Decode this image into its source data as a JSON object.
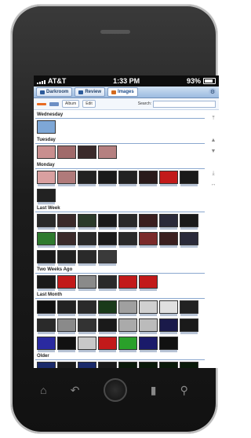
{
  "status": {
    "carrier": "AT&T",
    "time": "1:33 PM",
    "battery": "93%"
  },
  "tabs": [
    {
      "label": "Darkroom",
      "active": false
    },
    {
      "label": "Review",
      "active": false
    },
    {
      "label": "Images",
      "active": true
    }
  ],
  "toolbar": {
    "album_label": "Album",
    "edit_label": "Edit",
    "search_label": "Search:",
    "search_value": ""
  },
  "sections": [
    {
      "title": "Wednesday",
      "thumbs": [
        "#7ea7d6"
      ]
    },
    {
      "title": "Tuesday",
      "thumbs": [
        "#c98f8f",
        "#a06a6a",
        "#3a2a2a",
        "#b58080"
      ]
    },
    {
      "title": "Monday",
      "thumbs": [
        "#d9a0a0",
        "#b07a7a",
        "#222",
        "#1a1a1a",
        "#222",
        "#2a1a1a",
        "#c21a1a",
        "#1a1a1a",
        "#222"
      ]
    },
    {
      "title": "Last Week",
      "thumbs": [
        "#2a2a2a",
        "#3a2a2a",
        "#2a3a2a",
        "#1a1a1a",
        "#2a2a2a",
        "#3a1f1f",
        "#2a2a3a",
        "#1a1a1a",
        "#2e7a2e",
        "#3a2a2a",
        "#2a2a2a",
        "#1a1a1a",
        "#2a2a2a",
        "#7a2a2a",
        "#3a1f1f",
        "#2a2a3a",
        "#1a1a1a",
        "#222",
        "#2a2a2a",
        "#3a3a3a"
      ]
    },
    {
      "title": "Two Weeks Ago",
      "thumbs": [
        "#1a1a1a",
        "#c21a1a",
        "#8a8a8a",
        "#2a2a2a",
        "#c21a1a",
        "#c21a1a"
      ]
    },
    {
      "title": "Last Month",
      "thumbs": [
        "#111",
        "#222",
        "#2a2a2a",
        "#1a3a1a",
        "#a0a0a0",
        "#d0d0d0",
        "#e0e0e0",
        "#222",
        "#2a2a2a",
        "#8a8a8a",
        "#333",
        "#1a1a1a",
        "#aaa",
        "#bbb",
        "#1a1a4a",
        "#1a1a1a",
        "#2a2aa0",
        "#111",
        "#c8c8c8",
        "#c21a1a",
        "#2aa02a",
        "#1a1a6a",
        "#111"
      ]
    },
    {
      "title": "Older",
      "thumbs": [
        "#1a2a6a",
        "#1a1a1a",
        "#1a2a6a",
        "#1a1a1a",
        "#0a1a0a",
        "#0a1a0a",
        "#0a1a0a",
        "#0a1a0a",
        "#0a1a0a"
      ]
    }
  ],
  "icons": [
    "home-icon",
    "back-icon",
    "page-icon",
    "search-icon",
    "settings-icon"
  ]
}
